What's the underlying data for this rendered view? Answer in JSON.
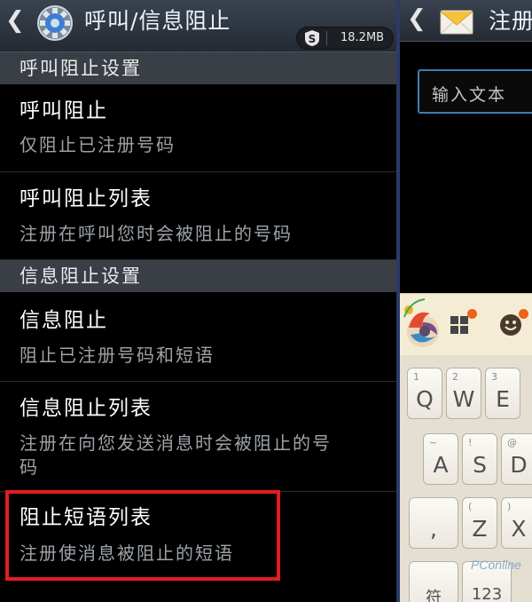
{
  "left": {
    "title": "呼叫/信息阻止",
    "memory_label": "18.2MB",
    "sections": [
      {
        "label": "呼叫阻止设置"
      },
      {
        "label": "信息阻止设置"
      }
    ],
    "items": [
      {
        "title": "呼叫阻止",
        "subtitle": "仅阻止已注册号码"
      },
      {
        "title": "呼叫阻止列表",
        "subtitle": "注册在呼叫您时会被阻止的号码"
      },
      {
        "title": "信息阻止",
        "subtitle": "阻止已注册号码和短语"
      },
      {
        "title": "信息阻止列表",
        "subtitle_line1": "注册在向您发送消息时会被阻止的号",
        "subtitle_line2": "码"
      },
      {
        "title": "阻止短语列表",
        "subtitle": "注册使消息被阻止的短语"
      }
    ],
    "highlight_color": "#e01e1e"
  },
  "right": {
    "title": "注册",
    "input_placeholder": "输入文本",
    "keys": {
      "q": {
        "main": "Q",
        "sup": "1"
      },
      "w": {
        "main": "W",
        "sup": "2"
      },
      "e": {
        "main": "E",
        "sup": "3"
      },
      "a": {
        "main": "A",
        "sup": "~"
      },
      "s": {
        "main": "S",
        "sup": "!"
      },
      "d": {
        "main": "D",
        "sup": "@"
      },
      "comma": {
        "main": ",",
        "sup": ""
      },
      "z": {
        "main": "Z",
        "sup": "("
      },
      "x": {
        "main": "X",
        "sup": ")"
      },
      "sym": {
        "main": "符",
        "sup": ""
      },
      "num": {
        "main": "123",
        "sup": ""
      }
    }
  },
  "watermark": "PConline",
  "colors": {
    "header": "#2e3640",
    "section": "#3a3e45",
    "input_border": "#3a7fb4",
    "keyboard_bg": "#e5dfd2",
    "accent_dot": "#f06018"
  }
}
